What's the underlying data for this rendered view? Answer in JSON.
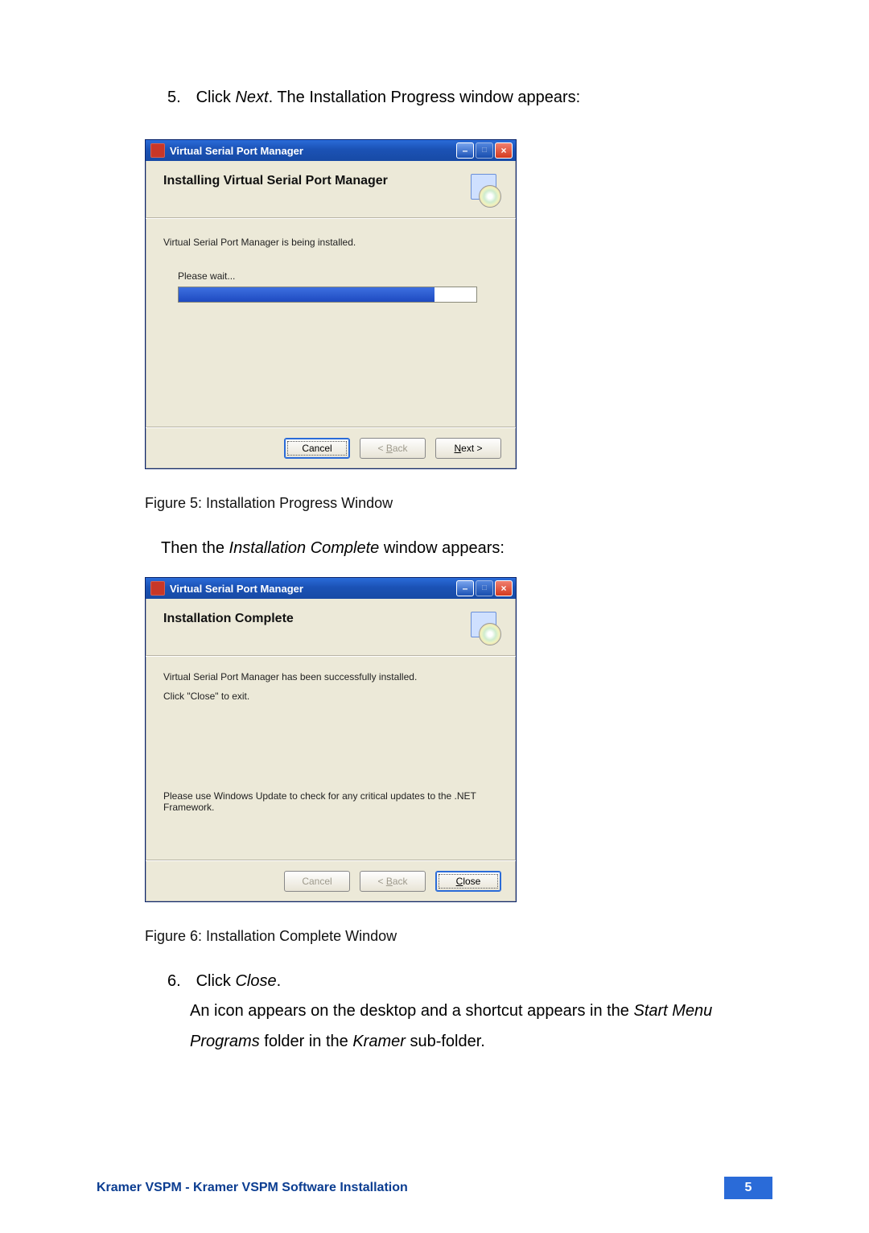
{
  "step5": {
    "number": "5.",
    "prefix": "Click ",
    "action_word": "Next",
    "suffix": ". The Installation Progress window appears:"
  },
  "dialog1": {
    "title": "Virtual Serial Port Manager",
    "heading": "Installing Virtual Serial Port Manager",
    "message": "Virtual Serial Port Manager is being installed.",
    "progress_label": "Please wait...",
    "progress_percent": 86,
    "buttons": {
      "cancel": "Cancel",
      "back": "< Back",
      "next": "Next >",
      "cancel_enabled": true,
      "back_enabled": false,
      "next_enabled": true,
      "focus": "cancel"
    }
  },
  "caption1": "Figure 5: Installation Progress Window",
  "between_text": {
    "prefix": "Then the ",
    "italic": "Installation Complete",
    "suffix": " window appears:"
  },
  "dialog2": {
    "title": "Virtual Serial Port Manager",
    "heading": "Installation Complete",
    "message1": "Virtual Serial Port Manager has been successfully installed.",
    "message2": "Click \"Close\" to exit.",
    "note": "Please use Windows Update to check for any critical updates to the .NET Framework.",
    "buttons": {
      "cancel": "Cancel",
      "back": "< Back",
      "close": "Close",
      "cancel_enabled": false,
      "back_enabled": false,
      "close_enabled": true,
      "focus": "close"
    }
  },
  "caption2": "Figure 6: Installation Complete Window",
  "step6": {
    "number": "6.",
    "prefix": "Click ",
    "action_word": "Close",
    "suffix": "."
  },
  "closing_para": {
    "part1": "An icon appears on the desktop and a shortcut appears in the ",
    "italic1": "Start Menu",
    "part2": " ",
    "italic2": "Programs",
    "part3": " folder in the ",
    "italic3": "Kramer",
    "part4": " sub-folder."
  },
  "footer": {
    "text": "Kramer VSPM - Kramer VSPM Software Installation",
    "page_number": "5"
  },
  "icons": {
    "minimize": "–",
    "maximize": "□",
    "close": "×"
  }
}
